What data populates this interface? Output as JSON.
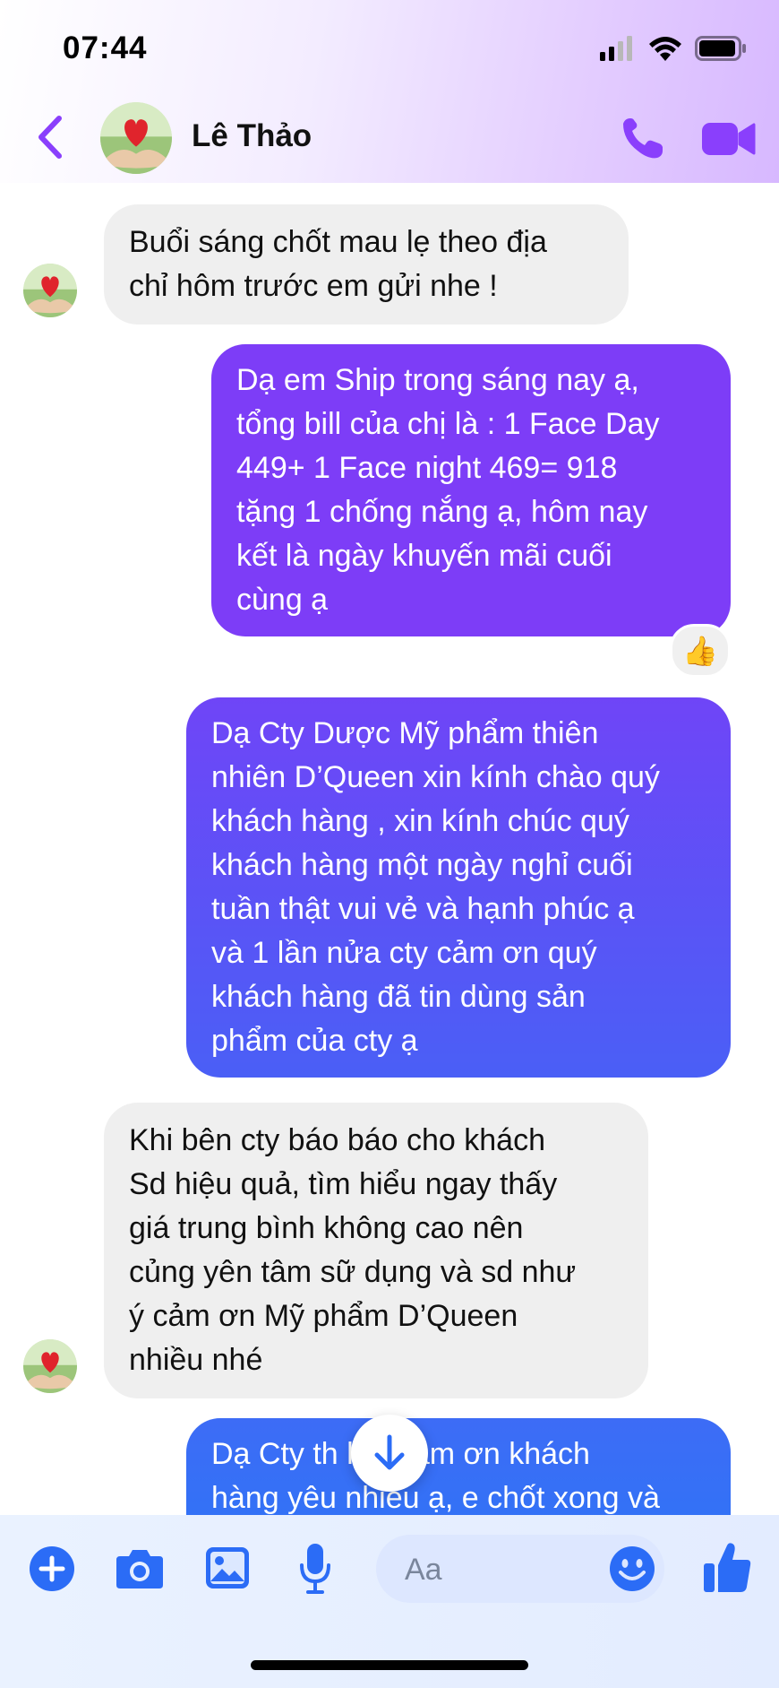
{
  "status_bar": {
    "time": "07:44"
  },
  "header": {
    "contact_name": "Lê Thảo"
  },
  "colors": {
    "accent": "#8a3ffc",
    "incoming_bubble": "#efefef",
    "outgoing_gradient_top": "#7d3df7",
    "outgoing_gradient_bottom": "#2e74f6",
    "composer_icon": "#2b6cf6"
  },
  "messages": [
    {
      "direction": "in",
      "lines": [
        "Buổi sáng chốt mau lẹ theo địa",
        "chỉ hôm trước em gửi nhe !"
      ]
    },
    {
      "direction": "out",
      "lines": [
        "Dạ em Ship trong sáng nay ạ,",
        "tổng bill của chị là : 1 Face Day",
        "449+ 1 Face night 469= 918",
        "tặng 1 chống nắng ạ, hôm nay",
        "kết là ngày khuyến mãi cuối",
        "cùng ạ"
      ],
      "reaction": "👍"
    },
    {
      "direction": "out",
      "lines": [
        "Dạ Cty Dược Mỹ phẩm thiên",
        "nhiên D’Queen xin kính chào quý",
        "khách hàng , xin kính chúc quý",
        "khách hàng một ngày nghỉ cuối",
        "tuần thật vui vẻ và hạnh phúc ạ",
        "và 1 lần nửa cty cảm ơn quý",
        "khách hàng đã tin dùng sản",
        "phẩm của cty ạ"
      ]
    },
    {
      "direction": "in",
      "lines": [
        "Khi bên cty báo báo cho khách",
        "Sd hiệu quả, tìm hiểu ngay thấy",
        "giá trung bình không cao nên",
        "củng yên tâm sữ dụng và sd như",
        "ý cảm ơn Mỹ phẩm D’Queen",
        "nhiều nhé"
      ]
    },
    {
      "direction": "out",
      "lines": [
        "Dạ Cty th      hật cảm ơn khách",
        "hàng yêu nhiều ạ, e chốt xong và"
      ]
    }
  ],
  "composer": {
    "placeholder": "Aa"
  },
  "icons": {
    "back": "chevron-left-icon",
    "call": "phone-icon",
    "video": "video-camera-icon",
    "add": "plus-circle-icon",
    "camera": "camera-icon",
    "gallery": "image-icon",
    "mic": "microphone-icon",
    "emoji": "smiley-icon",
    "like": "thumbs-up-icon",
    "scroll": "arrow-down-icon"
  }
}
